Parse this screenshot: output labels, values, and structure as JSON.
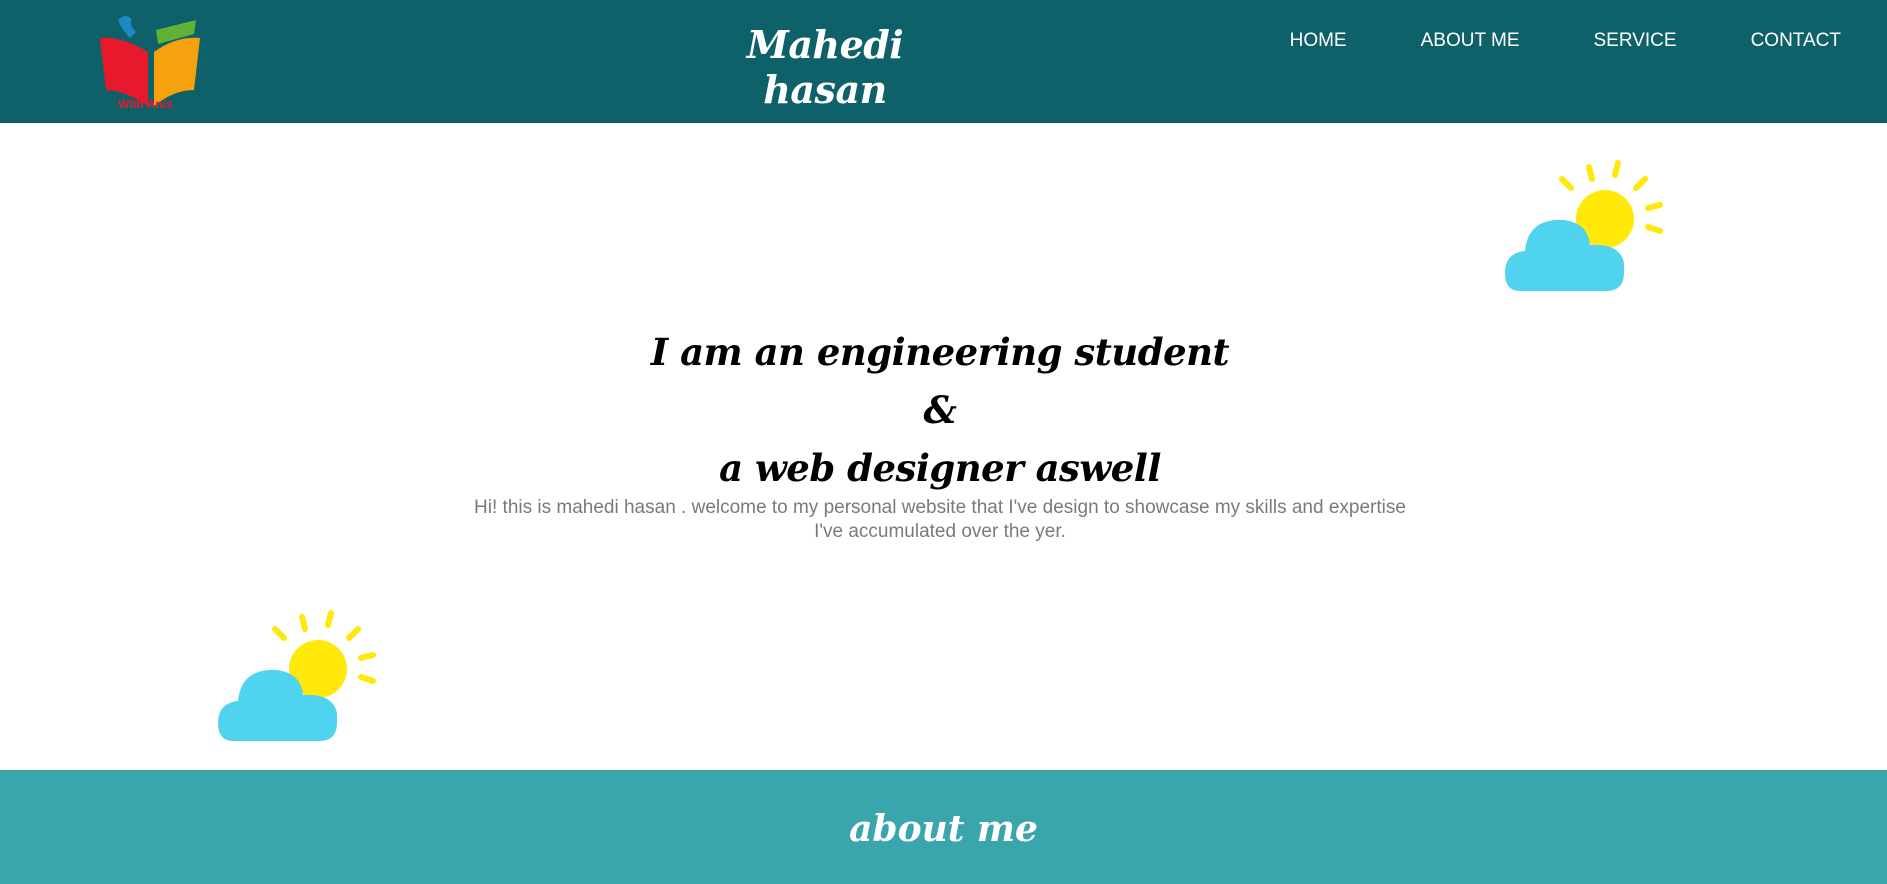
{
  "header": {
    "logo_text": "With Anis",
    "site_title": "Mahedi hasan",
    "nav": [
      {
        "label": "HOME"
      },
      {
        "label": "ABOUT ME"
      },
      {
        "label": "SERVICE"
      },
      {
        "label": "CONTACT"
      }
    ]
  },
  "hero": {
    "headline_line1": "I am an engineering student",
    "headline_line2": "&",
    "headline_line3": "a web designer aswell",
    "intro": "Hi! this is mahedi hasan . welcome to my personal website that I've design to showcase my skills and expertise I've accumulated over the yer."
  },
  "about": {
    "title": "about me"
  },
  "colors": {
    "header_bg": "#0e6168",
    "about_bg": "#3aa5ad",
    "cloud": "#50d3ef",
    "sun": "#ffe80a"
  },
  "icons": {
    "logo": "open-book-logo",
    "decor": "sun-behind-cloud-icon"
  }
}
